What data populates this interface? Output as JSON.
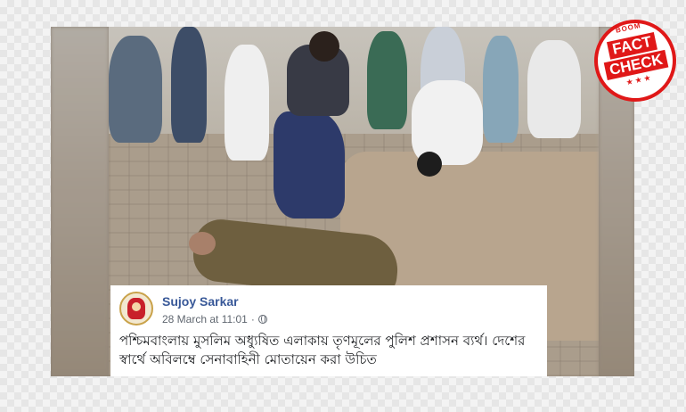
{
  "post": {
    "author": "Sujoy Sarkar",
    "date": "28 March at 11:01",
    "separator": "·",
    "privacy_icon": "globe-icon",
    "text": "পশ্চিমবাংলায় মুসলিম অধ্যুষিত এলাকায় তৃণমূলের পুলিশ প্রশাসন ব্যর্থ। দেশের স্বার্থে অবিলম্বে সেনাবাহিনী মোতায়েন করা উচিত"
  },
  "stamp": {
    "top_text": "BOOM",
    "line1": "FACT",
    "line2": "CHECK",
    "stars": "★★★",
    "color": "#e01818"
  },
  "colors": {
    "author_link": "#385898",
    "meta": "#606770",
    "text": "#1c1e21"
  }
}
